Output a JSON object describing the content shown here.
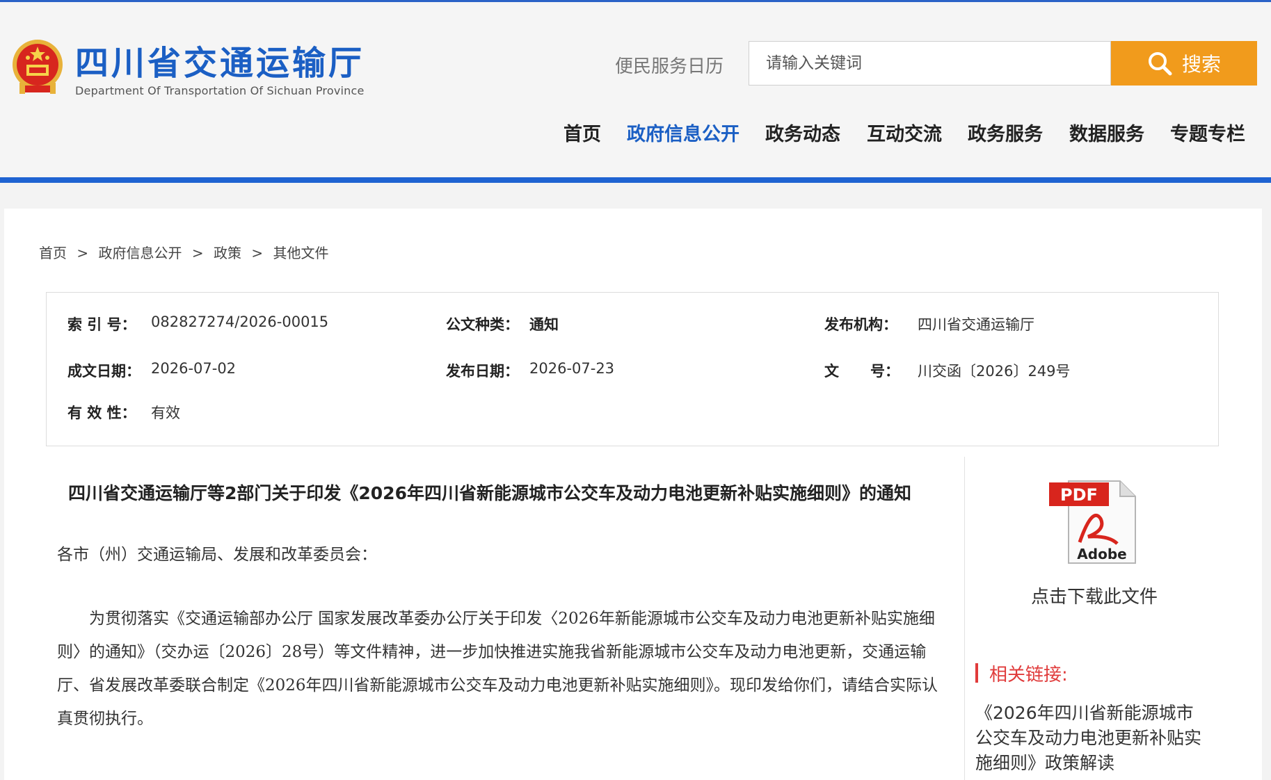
{
  "header": {
    "title": "四川省交通运输厅",
    "subtitle": "Department Of Transportation Of Sichuan Province",
    "calendar_link": "便民服务日历",
    "search_placeholder": "请输入关键词",
    "search_button": "搜索"
  },
  "nav": {
    "items": [
      {
        "label": "首页",
        "active": false
      },
      {
        "label": "政府信息公开",
        "active": true
      },
      {
        "label": "政务动态",
        "active": false
      },
      {
        "label": "互动交流",
        "active": false
      },
      {
        "label": "政务服务",
        "active": false
      },
      {
        "label": "数据服务",
        "active": false
      },
      {
        "label": "专题专栏",
        "active": false
      }
    ]
  },
  "breadcrumb": [
    "首页",
    ">",
    "政府信息公开",
    ">",
    "政策",
    ">",
    "其他文件"
  ],
  "meta": {
    "index_label": "索 引 号：",
    "index_value": "082827274/2026-00015",
    "doc_type_label": "公文种类：",
    "doc_type_value": "通知",
    "issuer_label": "发布机构：",
    "issuer_value": "四川省交通运输厅",
    "created_label": "成文日期：",
    "created_value": "2026-07-02",
    "published_label": "发布日期：",
    "published_value": "2026-07-23",
    "doc_no_label_1": "文",
    "doc_no_label_2": "号：",
    "doc_no_value": "川交函〔2026〕249号",
    "validity_label": "有 效 性：",
    "validity_value": "有效"
  },
  "document": {
    "title": "四川省交通运输厅等2部门关于印发《2026年四川省新能源城市公交车及动力电池更新补贴实施细则》的通知",
    "salutation": "各市（州）交通运输局、发展和改革委员会：",
    "paragraph": "为贯彻落实《交通运输部办公厅 国家发展改革委办公厅关于印发〈2026年新能源城市公交车及动力电池更新补贴实施细则〉的通知》（交办运〔2026〕28号）等文件精神，进一步加快推进实施我省新能源城市公交车及动力电池更新，交通运输厅、省发展改革委联合制定《2026年四川省新能源城市公交车及动力电池更新补贴实施细则》。现印发给你们，请结合实际认真贯彻执行。"
  },
  "sidebar": {
    "pdf_badge": "PDF",
    "pdf_brand": "Adobe",
    "download_text": "点击下载此文件",
    "related_title": "相关链接:",
    "related_link": "《2026年四川省新能源城市公交车及动力电池更新补贴实施细则》政策解读"
  },
  "colors": {
    "brand_blue": "#1b5fc4",
    "search_orange": "#f19b1c",
    "related_red": "#e03b3b"
  }
}
